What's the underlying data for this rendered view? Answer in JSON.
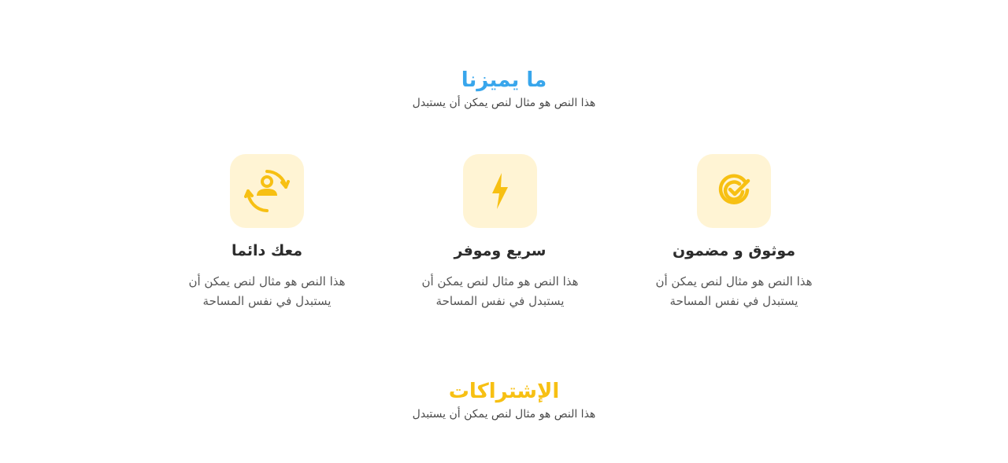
{
  "features_section": {
    "title": "ما يميزنا",
    "subtitle": "هذا النص هو مثال لنص يمكن أن يستبدل"
  },
  "features": [
    {
      "icon": "verified-check-icon",
      "title": "موثوق و مضمون",
      "description": "هذا النص هو مثال لنص يمكن أن يستبدل في نفس المساحة"
    },
    {
      "icon": "lightning-bolt-icon",
      "title": "سريع وموفر",
      "description": "هذا النص هو مثال لنص يمكن أن يستبدل في نفس المساحة"
    },
    {
      "icon": "user-support-icon",
      "title": "معك دائما",
      "description": "هذا النص هو مثال لنص يمكن أن يستبدل في نفس المساحة"
    }
  ],
  "subscriptions_section": {
    "title": "الإشتراكات",
    "subtitle": "هذا النص هو مثال لنص يمكن أن يستبدل"
  },
  "colors": {
    "features_title": "#38a6ec",
    "subscriptions_title": "#f7c013",
    "icon_accent": "#f7c013",
    "icon_background": "#fff4d4"
  }
}
